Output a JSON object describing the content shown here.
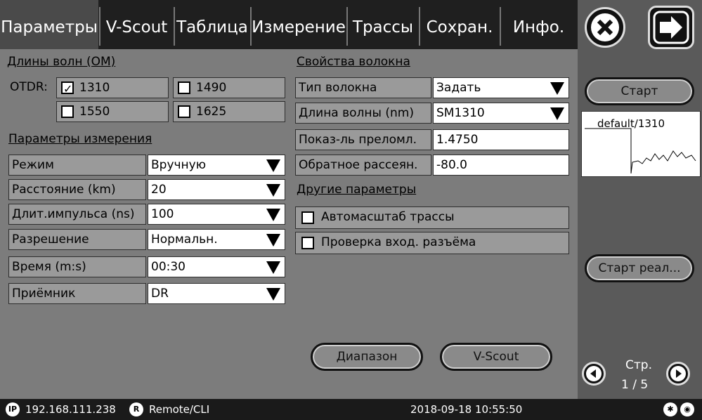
{
  "tabs": [
    "Параметры",
    "V-Scout",
    "Таблица",
    "Измерение",
    "Трассы",
    "Сохран.",
    "Инфо."
  ],
  "wavelengths": {
    "title": "Длины волн (ОМ)",
    "otdr_label": "OTDR:",
    "items": [
      {
        "label": "1310",
        "checked": true
      },
      {
        "label": "1490",
        "checked": false
      },
      {
        "label": "1550",
        "checked": false
      },
      {
        "label": "1625",
        "checked": false
      }
    ]
  },
  "measure": {
    "title": "Параметры измерения",
    "rows": [
      {
        "label": "Режим",
        "value": "Вручную"
      },
      {
        "label": "Расстояние (km)",
        "value": "20"
      },
      {
        "label": "Длит.импульса (ns)",
        "value": "100"
      },
      {
        "label": "Разрешение",
        "value": "Нормальн."
      },
      {
        "label": "Время (m:s)",
        "value": "00:30"
      },
      {
        "label": "Приёмник",
        "value": "DR"
      }
    ]
  },
  "fiber": {
    "title": "Свойства волокна",
    "rows": [
      {
        "label": "Тип волокна",
        "value": "Задать"
      },
      {
        "label": "Длина волны (nm)",
        "value": "SM1310"
      },
      {
        "label": "Показ-ль преломл.",
        "value": "1.4750"
      },
      {
        "label": "Обратное рассеян.",
        "value": "-80.0"
      }
    ]
  },
  "other": {
    "title": "Другие параметры",
    "options": [
      {
        "label": "Автомасштаб трассы",
        "checked": false
      },
      {
        "label": "Проверка вход. разъёма",
        "checked": false
      }
    ]
  },
  "buttons": {
    "range": "Диапазон",
    "vscout": "V-Scout"
  },
  "right": {
    "start": "Старт",
    "trace_label": "default/1310",
    "realtime": "Старт реал...",
    "page_label": "Стр.",
    "page_value": "1 / 5"
  },
  "status": {
    "ip": "192.168.111.238",
    "remote": "Remote/CLI",
    "datetime": "2018-09-18  10:55:50"
  }
}
